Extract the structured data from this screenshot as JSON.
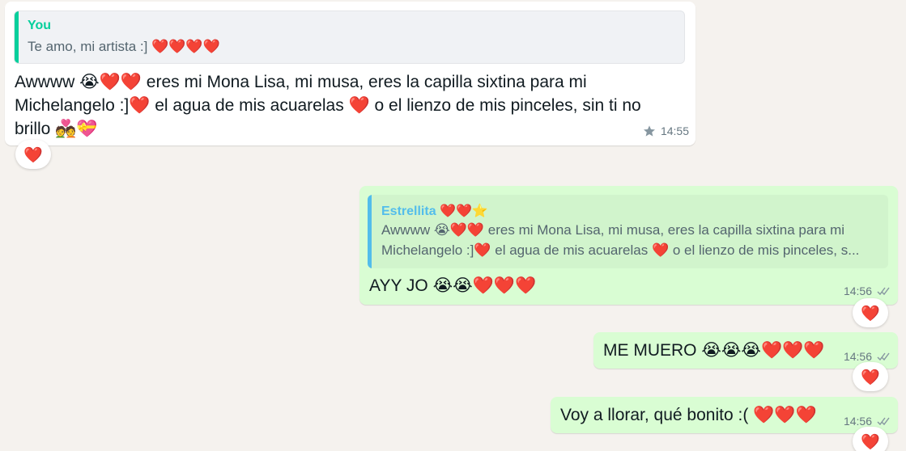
{
  "messages": [
    {
      "direction": "incoming",
      "quote": {
        "author": "You",
        "text": "Te amo, mi artista :] ❤️❤️❤️❤️"
      },
      "text": "Awwww 😭❤️❤️ eres mi Mona Lisa, mi musa, eres la capilla sixtina para mi Michelangelo :]❤️ el agua de mis acuarelas ❤️ o el lienzo de mis pinceles, sin ti no brillo 💑💝",
      "time": "14:55",
      "starred": true,
      "reaction": "❤️"
    },
    {
      "direction": "outgoing",
      "quote": {
        "author": "Estrellita ❤️❤️⭐",
        "text": "Awwww 😭❤️❤️ eres mi Mona Lisa, mi musa, eres la capilla sixtina para mi Michelangelo :]❤️ el agua de mis acuarelas ❤️ o el lienzo de mis pinceles, s..."
      },
      "text": "AYY JO 😭😭❤️❤️❤️",
      "time": "14:56",
      "status": "read",
      "reaction": "❤️"
    },
    {
      "direction": "outgoing",
      "text": "ME MUERO 😭😭😭❤️❤️❤️",
      "time": "14:56",
      "status": "read",
      "reaction": "❤️"
    },
    {
      "direction": "outgoing",
      "text": "Voy a llorar, qué bonito :( ❤️❤️❤️",
      "time": "14:56",
      "status": "read",
      "reaction": "❤️"
    }
  ],
  "colors": {
    "incoming_bubble": "#ffffff",
    "outgoing_bubble": "#d9fdd3",
    "you_author": "#06cf9c",
    "estrellita_author": "#53bdeb",
    "background": "#f5f2ee",
    "heart": "#e0245e"
  }
}
